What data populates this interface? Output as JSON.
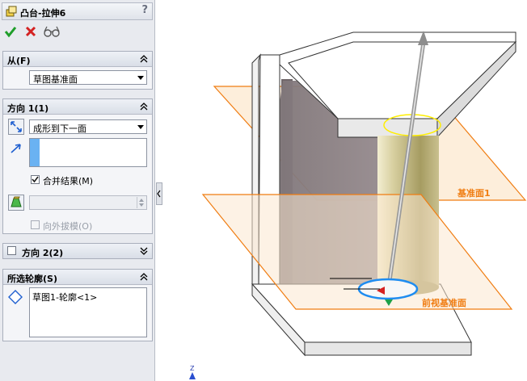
{
  "panel": {
    "title": "凸台-拉伸6",
    "help": "?",
    "actions": {
      "ok_icon": "checkmark-icon",
      "cancel_icon": "close-icon",
      "preview_icon": "glasses-icon"
    }
  },
  "from_group": {
    "title": "从(F)",
    "start_condition": "草图基准面"
  },
  "direction1": {
    "title": "方向 1(1)",
    "end_condition": "成形到下一面",
    "direction_value": "",
    "merge_result_label": "合并结果(M)",
    "merge_result_checked": true,
    "draft_value": "",
    "draft_outward_label": "向外拔模(O)",
    "draft_outward_checked": false
  },
  "direction2": {
    "title": "方向 2(2)",
    "checked": false
  },
  "selected_contours": {
    "title": "所选轮廓(S)",
    "items": [
      "草图1-轮廓<1>"
    ]
  },
  "viewport": {
    "plane1_label": "基准面1",
    "plane2_label": "前视基准面",
    "axis_label": "Z"
  },
  "colors": {
    "accent": "#f07d12",
    "plane_fill": "#fce8cf",
    "cylinder": "#c9c08e",
    "body_gray": "#8a8084",
    "panel_bg": "#e8eaef"
  }
}
